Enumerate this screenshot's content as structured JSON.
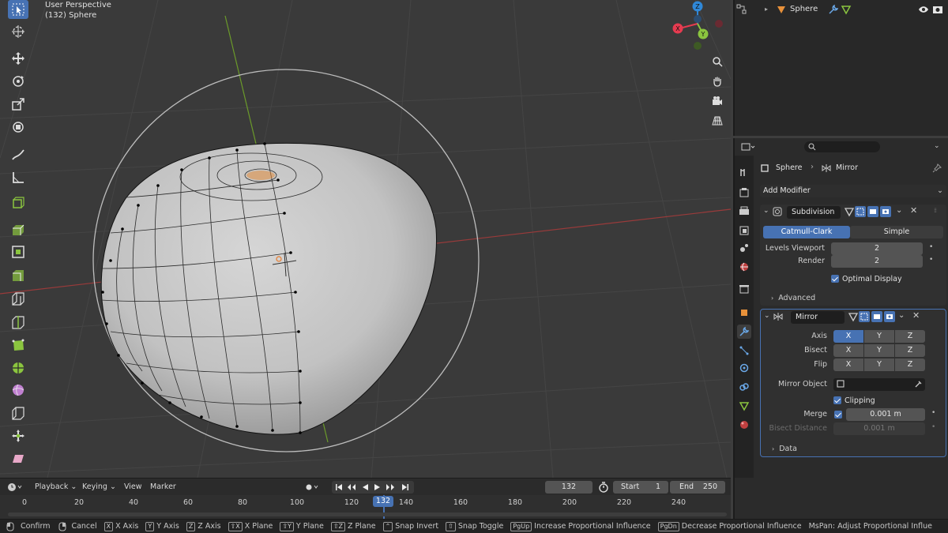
{
  "viewport": {
    "perspective_label": "User Perspective",
    "object_label": "(132) Sphere"
  },
  "gizmo": {
    "x": "X",
    "y": "Y",
    "z": "Z"
  },
  "outliner": {
    "object_name": "Sphere"
  },
  "properties": {
    "breadcrumb_object": "Sphere",
    "breadcrumb_modifier": "Mirror",
    "add_modifier": "Add Modifier",
    "subdivision": {
      "name": "Subdivision",
      "mode_catmull": "Catmull-Clark",
      "mode_simple": "Simple",
      "levels_viewport_label": "Levels Viewport",
      "levels_viewport": "2",
      "render_label": "Render",
      "render": "2",
      "optimal_display": "Optimal Display",
      "advanced": "Advanced"
    },
    "mirror": {
      "name": "Mirror",
      "axis_label": "Axis",
      "bisect_label": "Bisect",
      "flip_label": "Flip",
      "x": "X",
      "y": "Y",
      "z": "Z",
      "mirror_object_label": "Mirror Object",
      "clipping": "Clipping",
      "merge_label": "Merge",
      "merge_value": "0.001 m",
      "bisect_distance_label": "Bisect Distance",
      "bisect_distance_value": "0.001 m",
      "data": "Data"
    }
  },
  "timeline": {
    "playback": "Playback",
    "keying": "Keying",
    "view": "View",
    "marker": "Marker",
    "current_frame": "132",
    "start_label": "Start",
    "start": "1",
    "end_label": "End",
    "end": "250",
    "ticks": [
      "0",
      "20",
      "40",
      "60",
      "80",
      "100",
      "120",
      "140",
      "160",
      "180",
      "200",
      "220",
      "240"
    ],
    "frame_indicator": "132"
  },
  "statusbar": {
    "confirm": "Confirm",
    "cancel": "Cancel",
    "x_axis": "X Axis",
    "y_axis": "Y Axis",
    "z_axis": "Z Axis",
    "x_plane": "X Plane",
    "y_plane": "Y Plane",
    "z_plane": "Z Plane",
    "snap_invert": "Snap Invert",
    "snap_toggle": "Snap Toggle",
    "increase_prop": "Increase Proportional Influence",
    "decrease_prop": "Decrease Proportional Influence",
    "mspan": "MsPan: Adjust Proportional Influe",
    "keys": {
      "x": "X",
      "y": "Y",
      "z": "Z",
      "shift_x": "⇧X",
      "shift_y": "⇧Y",
      "shift_z": "⇧Z",
      "pgup": "PgUp",
      "pgdn": "PgDn"
    }
  },
  "colors": {
    "accent": "#4772b3",
    "x_axis": "#e63b50",
    "y_axis": "#8bc53f",
    "z_axis": "#2f88d8"
  }
}
